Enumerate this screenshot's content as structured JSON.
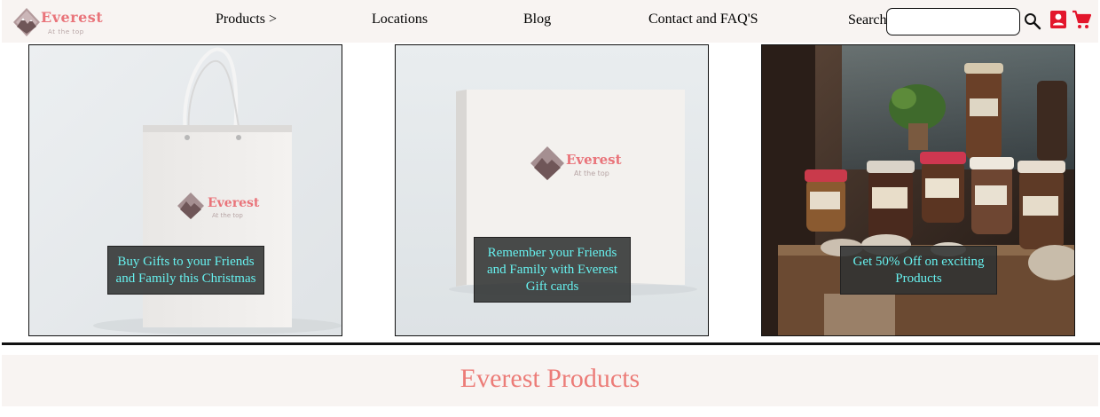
{
  "brand": {
    "name": "Everest",
    "tagline": "At the top"
  },
  "nav": {
    "products": "Products >",
    "locations": "Locations",
    "blog": "Blog",
    "contact": "Contact and FAQ'S"
  },
  "search": {
    "label": "Search",
    "value": ""
  },
  "icons": {
    "search": "search-icon",
    "account": "account-icon",
    "cart": "cart-icon"
  },
  "colors": {
    "accent": "#e9747a",
    "caption_text": "#66f0ee",
    "header_bg": "#f8f4f2"
  },
  "cards": [
    {
      "caption": "Buy Gifts to your Friends and Family this Christmas"
    },
    {
      "caption": "Remember your Friends and Family with Everest Gift cards"
    },
    {
      "caption": "Get 50% Off on exciting Products"
    }
  ],
  "section": {
    "title": "Everest Products"
  }
}
